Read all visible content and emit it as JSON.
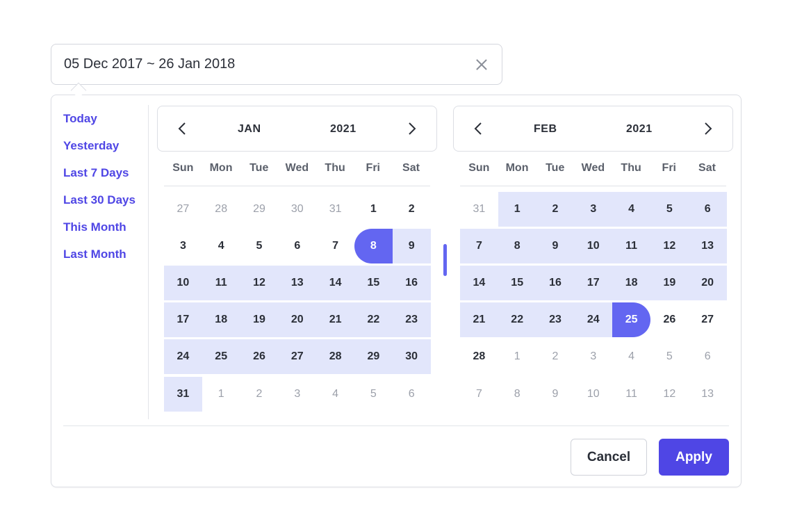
{
  "input": {
    "value": "05 Dec 2017 ~ 26 Jan 2018",
    "clear_icon": "close-icon"
  },
  "presets": [
    "Today",
    "Yesterday",
    "Last 7 Days",
    "Last 30 Days",
    "This Month",
    "Last Month"
  ],
  "weekdays": [
    "Sun",
    "Mon",
    "Tue",
    "Wed",
    "Thu",
    "Fri",
    "Sat"
  ],
  "calendars": [
    {
      "month": "JAN",
      "year": "2021",
      "prev_icon": "chevron-left-icon",
      "next_icon": "chevron-right-icon",
      "days": [
        [
          "27",
          "28",
          "29",
          "30",
          "31",
          "1",
          "2"
        ],
        [
          "3",
          "4",
          "5",
          "6",
          "7",
          "8",
          "9"
        ],
        [
          "10",
          "11",
          "12",
          "13",
          "14",
          "15",
          "16"
        ],
        [
          "17",
          "18",
          "19",
          "20",
          "21",
          "22",
          "23"
        ],
        [
          "24",
          "25",
          "26",
          "27",
          "28",
          "29",
          "30"
        ],
        [
          "31",
          "1",
          "2",
          "3",
          "4",
          "5",
          "6"
        ]
      ],
      "states": [
        [
          "muted",
          "muted",
          "muted",
          "muted",
          "muted",
          "",
          ""
        ],
        [
          "",
          "",
          "",
          "",
          "",
          "start",
          "inrange"
        ],
        [
          "inrange",
          "inrange",
          "inrange",
          "inrange",
          "inrange",
          "inrange",
          "inrange"
        ],
        [
          "inrange",
          "inrange",
          "inrange",
          "inrange",
          "inrange",
          "inrange",
          "inrange"
        ],
        [
          "inrange",
          "inrange",
          "inrange",
          "inrange",
          "inrange",
          "inrange",
          "inrange"
        ],
        [
          "inrange",
          "muted",
          "muted",
          "muted",
          "muted",
          "muted",
          "muted"
        ]
      ]
    },
    {
      "month": "FEB",
      "year": "2021",
      "prev_icon": "chevron-left-icon",
      "next_icon": "chevron-right-icon",
      "days": [
        [
          "31",
          "1",
          "2",
          "3",
          "4",
          "5",
          "6"
        ],
        [
          "7",
          "8",
          "9",
          "10",
          "11",
          "12",
          "13"
        ],
        [
          "14",
          "15",
          "16",
          "17",
          "18",
          "19",
          "20"
        ],
        [
          "21",
          "22",
          "23",
          "24",
          "25",
          "26",
          "27"
        ],
        [
          "28",
          "1",
          "2",
          "3",
          "4",
          "5",
          "6"
        ],
        [
          "7",
          "8",
          "9",
          "10",
          "11",
          "12",
          "13"
        ]
      ],
      "states": [
        [
          "muted",
          "inrange",
          "inrange",
          "inrange",
          "inrange",
          "inrange",
          "inrange"
        ],
        [
          "inrange",
          "inrange",
          "inrange",
          "inrange",
          "inrange",
          "inrange",
          "inrange"
        ],
        [
          "inrange",
          "inrange",
          "inrange",
          "inrange",
          "inrange",
          "inrange",
          "inrange"
        ],
        [
          "inrange",
          "inrange",
          "inrange",
          "inrange",
          "end",
          "",
          ""
        ],
        [
          "",
          "muted",
          "muted",
          "muted",
          "muted",
          "muted",
          "muted"
        ],
        [
          "muted",
          "muted",
          "muted",
          "muted",
          "muted",
          "muted",
          "muted"
        ]
      ]
    }
  ],
  "actions": {
    "cancel_label": "Cancel",
    "apply_label": "Apply"
  },
  "colors": {
    "accent": "#6366f1",
    "range": "#e2e6fb",
    "apply": "#4f46e5",
    "preset_text": "#4f46e5"
  }
}
